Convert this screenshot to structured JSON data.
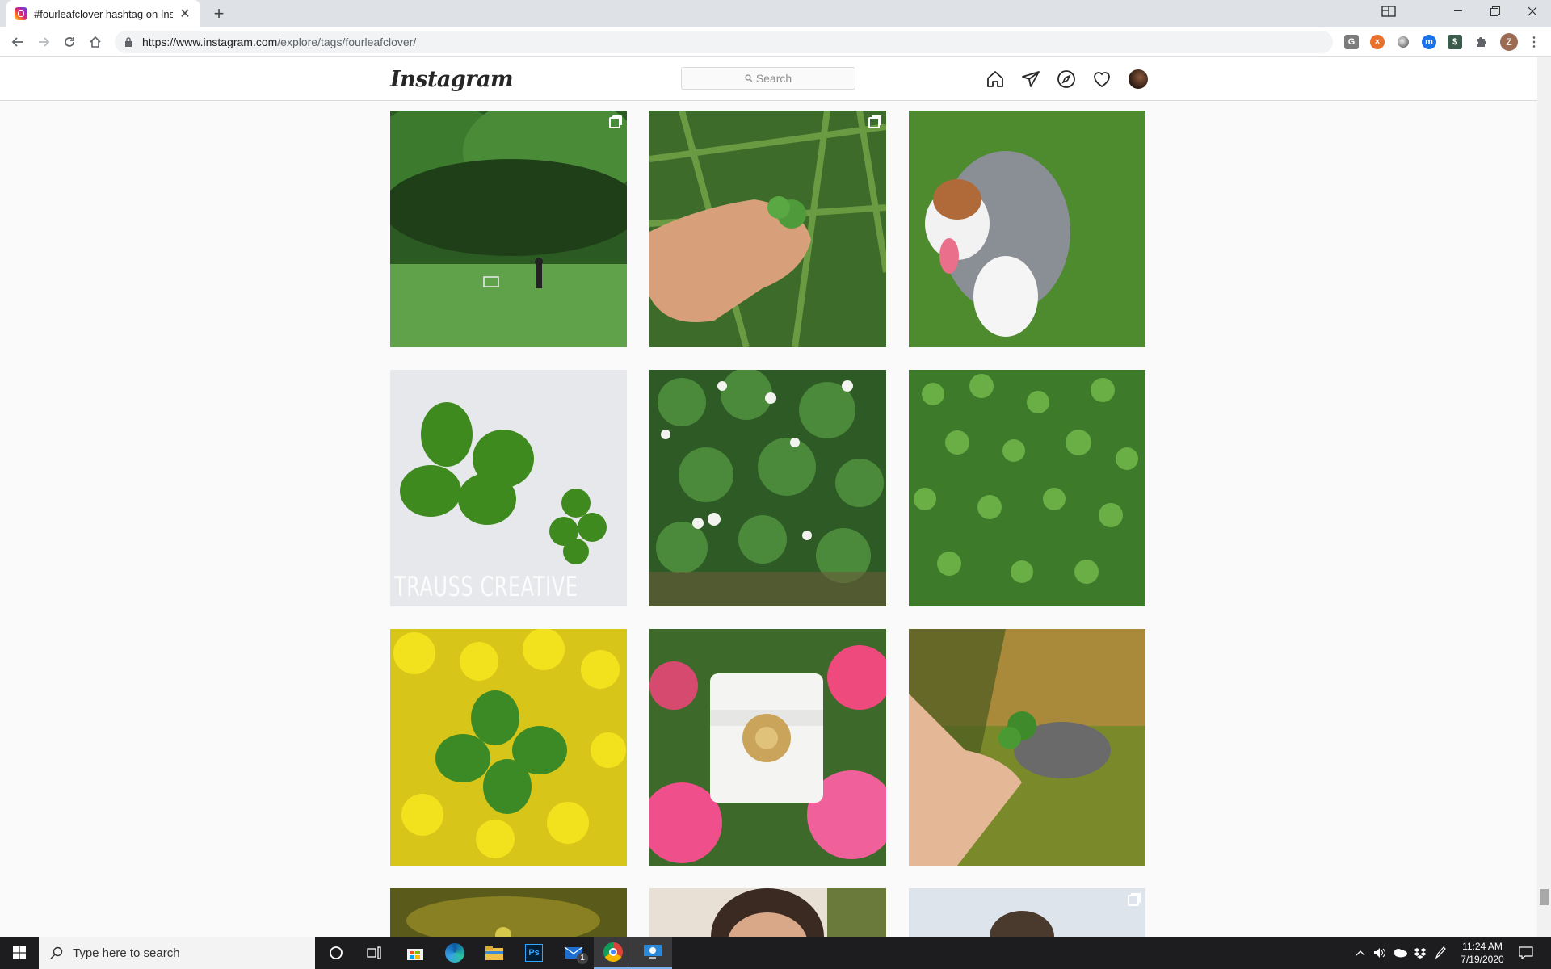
{
  "browser": {
    "tab_title": "#fourleafclover hashtag on Instag",
    "url_prefix": "https://www.instagram.com",
    "url_path": "/explore/tags/fourleafclover/",
    "profile_initial": "Z",
    "ext_icons": [
      "google-translate-icon",
      "block-icon",
      "circle-ext-icon",
      "m-ext-icon",
      "bookmark-ext-icon",
      "puzzle-icon"
    ]
  },
  "instagram": {
    "logo": "Instagram",
    "search_placeholder": "Search",
    "nav_icons": [
      "home-icon",
      "direct-icon",
      "explore-icon",
      "heart-icon",
      "avatar"
    ]
  },
  "posts": [
    {
      "scene": "forest clearing with soccer goal",
      "multi": true,
      "watermark": ""
    },
    {
      "scene": "hand holding four leaf clover in grass",
      "multi": true,
      "watermark": ""
    },
    {
      "scene": "australian shepherd puppy in clover",
      "multi": false,
      "watermark": ""
    },
    {
      "scene": "two four leaf clovers on white",
      "multi": false,
      "watermark": "TRAUSS CREATIVE"
    },
    {
      "scene": "white clover flowers",
      "multi": false,
      "watermark": ""
    },
    {
      "scene": "field of clover",
      "multi": false,
      "watermark": ""
    },
    {
      "scene": "clover among yellow daisies",
      "multi": false,
      "watermark": ""
    },
    {
      "scene": "gold clover cuff on pink flowers",
      "multi": false,
      "watermark": ""
    },
    {
      "scene": "hand holding clover near dog",
      "multi": false,
      "watermark": ""
    },
    {
      "scene": "sunset bokeh",
      "multi": false,
      "watermark": ""
    },
    {
      "scene": "girl portrait",
      "multi": false,
      "watermark": ""
    },
    {
      "scene": "person outdoors",
      "multi": true,
      "watermark": ""
    }
  ],
  "taskbar": {
    "search_placeholder": "Type here to search",
    "time": "11:24 AM",
    "date": "7/19/2020",
    "mail_badge": "1"
  }
}
